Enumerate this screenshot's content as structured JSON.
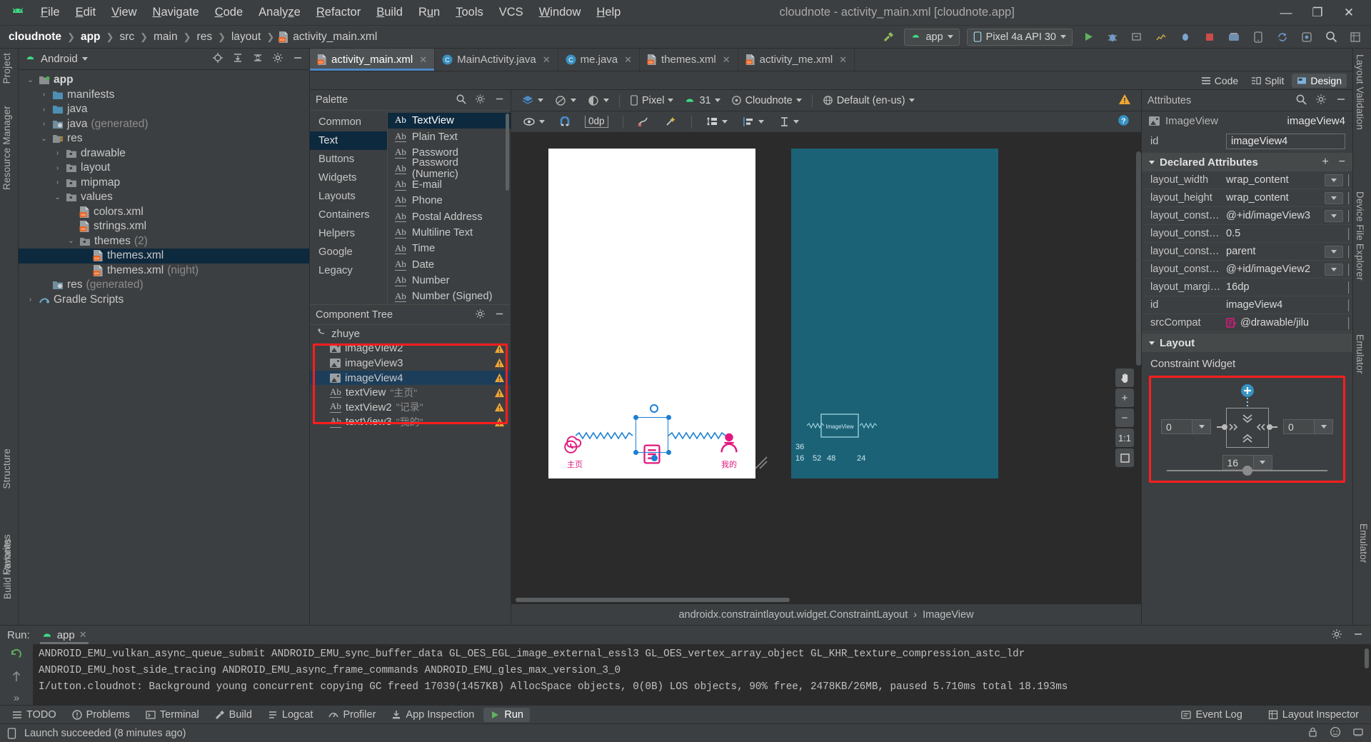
{
  "window": {
    "title": "cloudnote - activity_main.xml [cloudnote.app]",
    "menus": [
      "File",
      "Edit",
      "View",
      "Navigate",
      "Code",
      "Analyze",
      "Refactor",
      "Build",
      "Run",
      "Tools",
      "VCS",
      "Window",
      "Help"
    ],
    "controls": {
      "minimize": "—",
      "maximize": "❐",
      "close": "✕"
    }
  },
  "breadcrumb": {
    "items": [
      "cloudnote",
      "app",
      "src",
      "main",
      "res",
      "layout",
      "activity_main.xml"
    ]
  },
  "toolbar": {
    "run_config": "app",
    "device": "Pixel 4a API 30",
    "icons": [
      "build-hammer-icon",
      "run-icon",
      "debug-icon",
      "profile-icon",
      "attach-debugger-icon",
      "stop-icon",
      "sdk-manager-icon",
      "avd-manager-icon",
      "sync-gradle-icon",
      "search-icon",
      "layout-inspector-icon"
    ]
  },
  "project_panel": {
    "title": "Android",
    "actions": [
      "locate-icon",
      "expand-all-icon",
      "collapse-all-icon",
      "settings-icon",
      "hide-icon"
    ],
    "tree": [
      {
        "label": "app",
        "depth": 0,
        "arrow": "⌄",
        "type": "module",
        "bold": true
      },
      {
        "label": "manifests",
        "depth": 1,
        "arrow": "›",
        "type": "folder-blue"
      },
      {
        "label": "java",
        "depth": 1,
        "arrow": "›",
        "type": "folder-blue"
      },
      {
        "label": "java",
        "suffix": "(generated)",
        "depth": 1,
        "arrow": "›",
        "type": "folder-gen"
      },
      {
        "label": "res",
        "depth": 1,
        "arrow": "⌄",
        "type": "folder-res"
      },
      {
        "label": "drawable",
        "depth": 2,
        "arrow": "›",
        "type": "folder-grey"
      },
      {
        "label": "layout",
        "depth": 2,
        "arrow": "›",
        "type": "folder-grey"
      },
      {
        "label": "mipmap",
        "depth": 2,
        "arrow": "›",
        "type": "folder-grey"
      },
      {
        "label": "values",
        "depth": 2,
        "arrow": "⌄",
        "type": "folder-grey"
      },
      {
        "label": "colors.xml",
        "depth": 3,
        "arrow": "",
        "type": "xml"
      },
      {
        "label": "strings.xml",
        "depth": 3,
        "arrow": "",
        "type": "xml"
      },
      {
        "label": "themes",
        "suffix": "(2)",
        "depth": 3,
        "arrow": "⌄",
        "type": "folder-grey"
      },
      {
        "label": "themes.xml",
        "depth": 4,
        "arrow": "",
        "type": "xml",
        "selected": true
      },
      {
        "label": "themes.xml",
        "suffix": "(night)",
        "depth": 4,
        "arrow": "",
        "type": "xml"
      },
      {
        "label": "res",
        "suffix": "(generated)",
        "depth": 1,
        "arrow": "",
        "type": "folder-gen"
      },
      {
        "label": "Gradle Scripts",
        "depth": 0,
        "arrow": "›",
        "type": "gradle"
      }
    ]
  },
  "editor_tabs": [
    {
      "label": "activity_main.xml",
      "icon": "xml-file-icon",
      "active": true
    },
    {
      "label": "MainActivity.java",
      "icon": "java-class-icon",
      "active": false
    },
    {
      "label": "me.java",
      "icon": "java-class-icon",
      "active": false
    },
    {
      "label": "themes.xml",
      "icon": "xml-file-icon",
      "active": false
    },
    {
      "label": "activity_me.xml",
      "icon": "xml-file-icon",
      "active": false
    }
  ],
  "view_modes": [
    {
      "label": "Code",
      "active": false
    },
    {
      "label": "Split",
      "active": false
    },
    {
      "label": "Design",
      "active": true
    }
  ],
  "palette": {
    "title": "Palette",
    "actions": [
      "search-icon",
      "settings-icon",
      "hide-icon"
    ],
    "groups": [
      {
        "label": "Common",
        "selected": false
      },
      {
        "label": "Text",
        "selected": true
      },
      {
        "label": "Buttons",
        "selected": false
      },
      {
        "label": "Widgets",
        "selected": false
      },
      {
        "label": "Layouts",
        "selected": false
      },
      {
        "label": "Containers",
        "selected": false
      },
      {
        "label": "Helpers",
        "selected": false
      },
      {
        "label": "Google",
        "selected": false
      },
      {
        "label": "Legacy",
        "selected": false
      }
    ],
    "items": [
      {
        "label": "TextView",
        "selected": true
      },
      {
        "label": "Plain Text",
        "selected": false
      },
      {
        "label": "Password",
        "selected": false
      },
      {
        "label": "Password (Numeric)",
        "selected": false
      },
      {
        "label": "E-mail",
        "selected": false
      },
      {
        "label": "Phone",
        "selected": false
      },
      {
        "label": "Postal Address",
        "selected": false
      },
      {
        "label": "Multiline Text",
        "selected": false
      },
      {
        "label": "Time",
        "selected": false
      },
      {
        "label": "Date",
        "selected": false
      },
      {
        "label": "Number",
        "selected": false
      },
      {
        "label": "Number (Signed)",
        "selected": false
      }
    ]
  },
  "component_tree": {
    "title": "Component Tree",
    "actions": [
      "settings-icon",
      "hide-icon"
    ],
    "root": "zhuye",
    "nodes": [
      {
        "label": "imageView2",
        "type": "ImageView",
        "warn": true,
        "selected": false,
        "value": ""
      },
      {
        "label": "imageView3",
        "type": "ImageView",
        "warn": true,
        "selected": false,
        "value": ""
      },
      {
        "label": "imageView4",
        "type": "ImageView",
        "warn": true,
        "selected": true,
        "value": ""
      },
      {
        "label": "textView",
        "type": "TextView",
        "warn": true,
        "selected": false,
        "value": "\"主页\""
      },
      {
        "label": "textView2",
        "type": "TextView",
        "warn": true,
        "selected": false,
        "value": "\"记录\""
      },
      {
        "label": "textView3",
        "type": "TextView",
        "warn": true,
        "selected": false,
        "value": "\"我的\""
      }
    ]
  },
  "design_toolbar": {
    "left_icons": [
      "layers-icon",
      "blueprint-icon",
      "theme-icon"
    ],
    "device": "Pixel",
    "api": "31",
    "theme": "Cloudnote",
    "locale": "Default (en-us)",
    "warning_icon": "warning-icon",
    "row2": {
      "margin_value": "0dp",
      "help_icon": "help-icon",
      "icons": [
        "view-options-icon",
        "magnet-icon",
        "clear-constraints-icon",
        "infer-constraints-icon",
        "pack-icon",
        "align-icon",
        "guidelines-icon"
      ]
    }
  },
  "canvas": {
    "nav_items": [
      {
        "label": "主页",
        "icon": "cloud-clock-icon"
      },
      {
        "label": "",
        "icon": "note-lines-icon"
      },
      {
        "label": "我的",
        "icon": "person-icon"
      }
    ],
    "zoom_controls": [
      "pan-icon",
      "zoom-in",
      "zoom-out",
      "1:1",
      "fit-screen"
    ],
    "zoom_plus": "+",
    "zoom_minus": "−",
    "zoom_ratio": "1:1",
    "blueprint_label": "ImageView",
    "blueprint_nums": [
      "36",
      "16",
      "52",
      "48",
      "24"
    ]
  },
  "footer_breadcrumb": {
    "parent": "androidx.constraintlayout.widget.ConstraintLayout",
    "child": "ImageView",
    "separator": "›"
  },
  "attributes": {
    "title": "Attributes",
    "actions": [
      "search-icon",
      "settings-icon",
      "hide-icon"
    ],
    "component_type": "ImageView",
    "component_id": "imageView4",
    "id_label": "id",
    "id_value": "imageView4",
    "declared_header": "Declared Attributes",
    "declared_add": "+",
    "declared_remove": "−",
    "rows": [
      {
        "name": "layout_width",
        "value": "wrap_content",
        "dropdown": true
      },
      {
        "name": "layout_height",
        "value": "wrap_content",
        "dropdown": true
      },
      {
        "name": "layout_constraint…",
        "value": "@+id/imageView3",
        "dropdown": true
      },
      {
        "name": "layout_constraint…",
        "value": "0.5",
        "dropdown": false
      },
      {
        "name": "layout_constraint…",
        "value": "parent",
        "dropdown": true
      },
      {
        "name": "layout_constraint…",
        "value": "@+id/imageView2",
        "dropdown": true
      },
      {
        "name": "layout_marginBot…",
        "value": "16dp",
        "dropdown": false
      },
      {
        "name": "id",
        "value": "imageView4",
        "dropdown": false
      },
      {
        "name": "srcCompat",
        "value": "@drawable/jilu",
        "dropdown": false,
        "icon": "drawable-icon"
      }
    ],
    "layout_header": "Layout",
    "constraint_widget_label": "Constraint Widget",
    "constraint_left": "0",
    "constraint_right": "0",
    "constraint_bottom": "16"
  },
  "rails": {
    "left": [
      "Project",
      "Resource Manager",
      "Structure",
      "Favorites"
    ],
    "right": [
      "Layout Validation",
      "Device File Explorer",
      "Emulator",
      "Build Variants"
    ]
  },
  "run_panel": {
    "label": "Run:",
    "tab": "app",
    "close": "✕",
    "actions": [
      "settings-icon",
      "hide-icon"
    ],
    "gutter_icons": [
      "rerun-icon",
      "scroll-up-icon",
      "expand-icon",
      "collapse-icon"
    ],
    "lines": [
      "ANDROID_EMU_vulkan_async_queue_submit ANDROID_EMU_sync_buffer_data GL_OES_EGL_image_external_essl3 GL_OES_vertex_array_object GL_KHR_texture_compression_astc_ldr",
      "ANDROID_EMU_host_side_tracing ANDROID_EMU_async_frame_commands ANDROID_EMU_gles_max_version_3_0",
      "I/utton.cloudnot: Background young concurrent copying GC freed 17039(1457KB) AllocSpace objects, 0(0B) LOS objects, 90% free, 2478KB/26MB, paused 5.710ms total 18.193ms"
    ]
  },
  "tool_windows": [
    {
      "label": "TODO",
      "icon": "todo-icon",
      "active": false
    },
    {
      "label": "Problems",
      "icon": "problems-icon",
      "active": false
    },
    {
      "label": "Terminal",
      "icon": "terminal-icon",
      "active": false
    },
    {
      "label": "Build",
      "icon": "build-icon",
      "active": false
    },
    {
      "label": "Logcat",
      "icon": "logcat-icon",
      "active": false
    },
    {
      "label": "Profiler",
      "icon": "profiler-icon",
      "active": false
    },
    {
      "label": "App Inspection",
      "icon": "app-inspection-icon",
      "active": false
    },
    {
      "label": "Run",
      "icon": "run-icon",
      "active": true
    }
  ],
  "tool_windows_right": [
    {
      "label": "Event Log",
      "icon": "event-log-icon"
    },
    {
      "label": "Layout Inspector",
      "icon": "layout-inspector-icon"
    }
  ],
  "status_bar": {
    "message": "Launch succeeded (8 minutes ago)",
    "icon": "device-icon",
    "right_icons": [
      "lock-icon",
      "notification-icon",
      "memory-icon"
    ]
  },
  "colors": {
    "bg": "#3c3f41",
    "canvas_bg": "#2b2b2b",
    "selection": "#0d293e",
    "accent_blue": "#4a88c7",
    "highlight_red": "#ff1e1e",
    "pink": "#e0187e",
    "blueprint": "#1c6276",
    "warn_orange": "#f0a732"
  }
}
